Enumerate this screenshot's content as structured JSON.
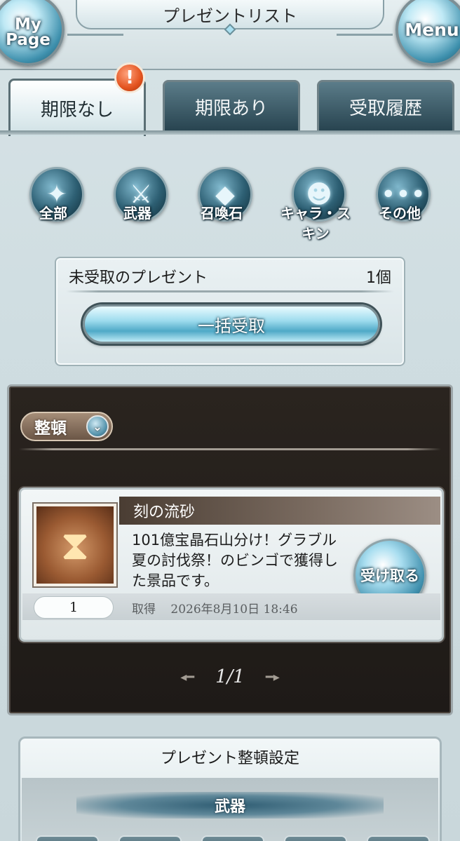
{
  "header": {
    "title": "プレゼントリスト",
    "mypage_label": "My Page",
    "menu_label": "Menu"
  },
  "tabs": [
    {
      "label": "期限なし",
      "active": true,
      "badge": "!"
    },
    {
      "label": "期限あり",
      "active": false
    },
    {
      "label": "受取履歴",
      "active": false
    }
  ],
  "categories": [
    {
      "label": "全部",
      "icon": "all-icon"
    },
    {
      "label": "武器",
      "icon": "sword-icon"
    },
    {
      "label": "召喚石",
      "icon": "crystal-icon"
    },
    {
      "label": "キャラ・スキン",
      "icon": "character-icon"
    },
    {
      "label": "その他",
      "icon": "more-icon"
    }
  ],
  "unreceived": {
    "label": "未受取のプレゼント",
    "count": "1個",
    "bulk_button": "一括受取"
  },
  "list": {
    "sort_label": "整頓",
    "items": [
      {
        "name": "刻の流砂",
        "icon": "hourglass-icon",
        "description": "101億宝晶石山分け！グラブル夏の討伐祭！のビンゴで獲得した景品です。",
        "quantity": "1",
        "acquired_label": "取得",
        "acquired_date": "2026年8月10日 18:46",
        "receive_button": "受け取る"
      }
    ],
    "pager": "1/1"
  },
  "settings": {
    "title": "プレゼント整頓設定",
    "section": "武器"
  },
  "colors": {
    "accent": "#4fa9c7",
    "dark_panel": "#1e1a17",
    "badge": "#e3531f"
  }
}
